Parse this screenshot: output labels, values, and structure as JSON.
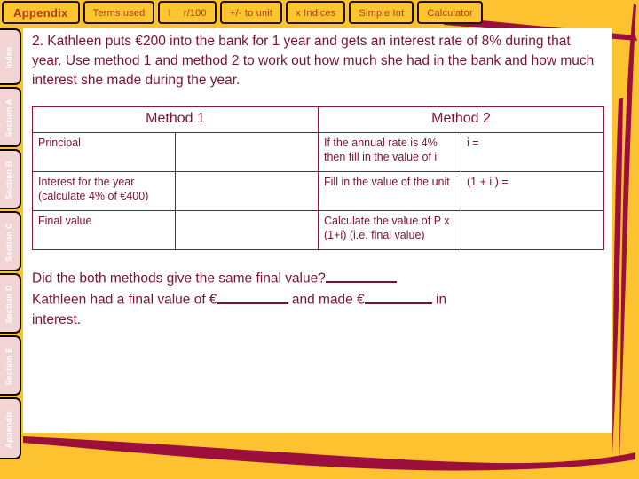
{
  "colors": {
    "gold": "#FCC230",
    "crimson": "#9C0E3C",
    "maroon_text": "#7B1236",
    "tab_face": "#FDC52E",
    "tab_text": "#B03A1B",
    "rail_face": "#F2D4D4",
    "rail_text": "#FFFFFF",
    "page": "#FFFFFF",
    "table_border": "#8E1540"
  },
  "tabbar": {
    "tabs": [
      {
        "label": "Appendix",
        "active": true
      },
      {
        "label": "Terms used",
        "active": false
      },
      {
        "label": "I",
        "label2": "r/100",
        "active": false
      },
      {
        "label": "+/-  to unit",
        "active": false
      },
      {
        "label": "x  Indices",
        "active": false
      },
      {
        "label": "Simple Int",
        "active": false
      },
      {
        "label": "Calculator",
        "active": false
      }
    ]
  },
  "rail": {
    "items": [
      {
        "label": "Index"
      },
      {
        "label": "Section A"
      },
      {
        "label": "Section B"
      },
      {
        "label": "Section C"
      },
      {
        "label": "Section D"
      },
      {
        "label": "Section E"
      },
      {
        "label": "Appendix"
      }
    ]
  },
  "question": {
    "text": "2. Kathleen puts €200 into the bank for 1 year and gets an interest rate of 8% during that year. Use method 1 and method 2 to work out how much she had in the bank and how much interest she made during the year."
  },
  "table": {
    "headers": [
      "Method 1",
      "Method 2"
    ],
    "rows": [
      {
        "m1_label": "Principal",
        "m1_value": "",
        "m2_label": "If the annual rate is 4% then fill in the value of i",
        "m2_value": "i ="
      },
      {
        "m1_label": "Interest for the year (calculate 4% of €400)",
        "m1_value": "",
        "m2_label": "Fill in the value of the unit",
        "m2_value": "(1 + i ) ="
      },
      {
        "m1_label": "Final value",
        "m1_value": "",
        "m2_label": "Calculate the value of P x (1+i) (i.e. final value)",
        "m2_value": ""
      }
    ]
  },
  "closing": {
    "line1_a": "Did the both methods give the same final value?",
    "line2_a": "Kathleen had a final value of €",
    "line2_b": "and made €",
    "line2_c": "in",
    "line3": "interest."
  }
}
